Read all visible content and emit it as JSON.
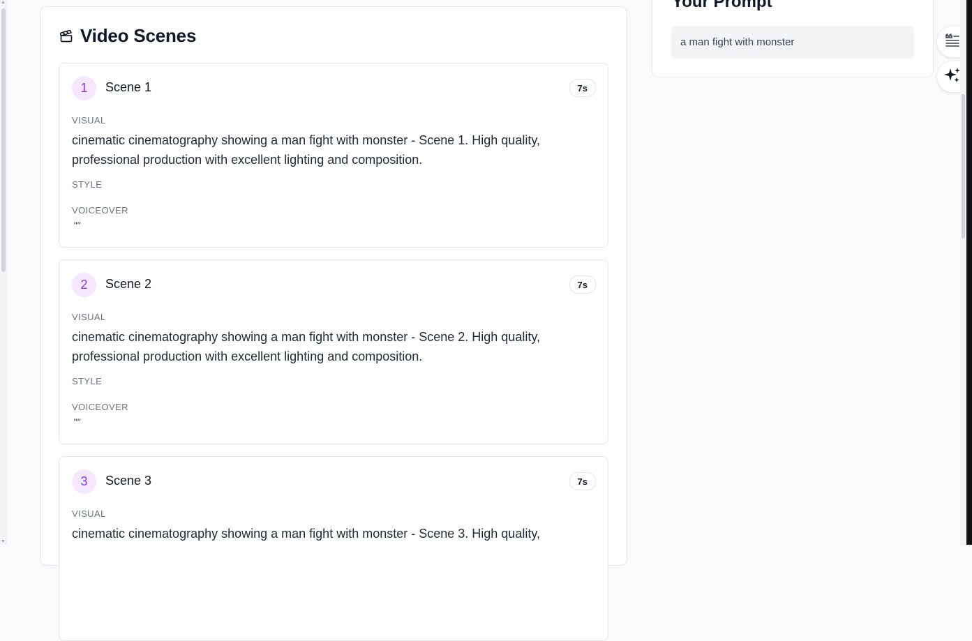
{
  "main": {
    "title": "Video Scenes",
    "field_labels": {
      "visual": "VISUAL",
      "style": "STYLE",
      "voiceover": "VOICEOVER"
    },
    "scenes": [
      {
        "number": "1",
        "title": "Scene 1",
        "duration": "7s",
        "visual": "cinematic cinematography showing a man fight with monster - Scene 1. High quality, professional production with excellent lighting and composition.",
        "voiceover": "\"\""
      },
      {
        "number": "2",
        "title": "Scene 2",
        "duration": "7s",
        "visual": "cinematic cinematography showing a man fight with monster - Scene 2. High quality, professional production with excellent lighting and composition.",
        "voiceover": "\"\""
      },
      {
        "number": "3",
        "title": "Scene 3",
        "duration": "7s",
        "visual": "cinematic cinematography showing a man fight with monster - Scene 3. High quality,",
        "voiceover": "\"\""
      }
    ]
  },
  "prompt_panel": {
    "title": "Your Prompt",
    "prompt_text": "a man fight with monster"
  },
  "side_buttons": {
    "top_icon": "quote-lines-icon",
    "bottom_icon": "sparkles-icon"
  },
  "colors": {
    "accent": "#9333ea",
    "accent_bg": "#f3e8ff"
  }
}
